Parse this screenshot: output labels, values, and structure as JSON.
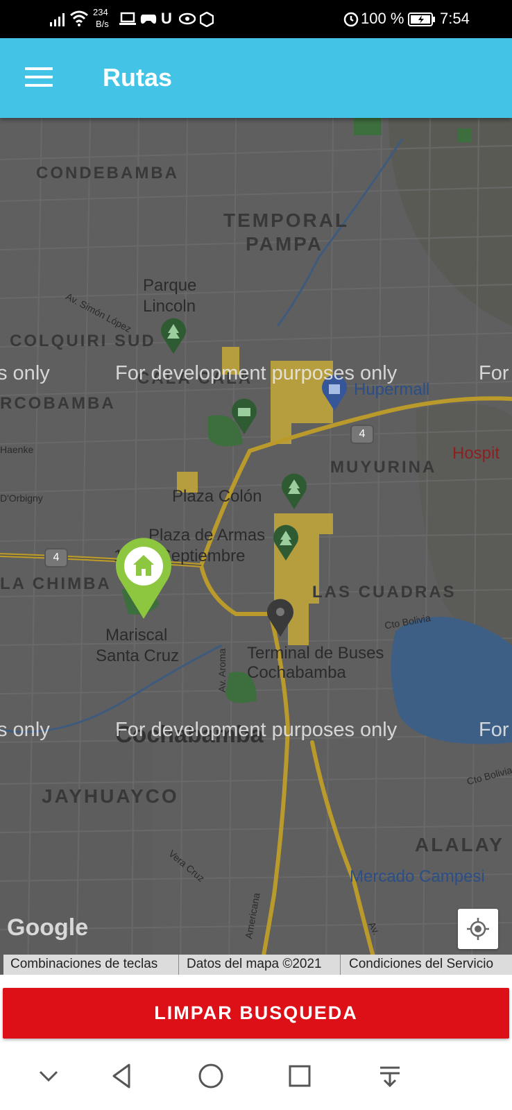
{
  "status_bar": {
    "net_speed_value": "234",
    "net_speed_unit": "B/s",
    "battery_percent": "100 %",
    "time": "7:54",
    "icons": [
      "signal-icon",
      "wifi-icon",
      "laptop-icon",
      "controller-icon",
      "u-icon",
      "eye-icon",
      "hex-icon",
      "alarm-icon",
      "battery-icon"
    ]
  },
  "app_bar": {
    "title": "Rutas",
    "menu_icon": "hamburger-menu-icon"
  },
  "map": {
    "neighborhoods": [
      "CONDEBAMBA",
      "TEMPORAL",
      "PAMPA",
      "COLQUIRI SUD",
      "RCOBAMBA",
      "MUYURINA",
      "LA CHIMBA",
      "LAS CUADRAS",
      "JAYHUAYCO",
      "ALALAY"
    ],
    "places": {
      "parque_lincoln_1": "Parque",
      "parque_lincoln_2": "Lincoln",
      "hupermall": "Hupermall",
      "hospit": "Hospit",
      "plaza_colon": "Plaza Colón",
      "plaza_armas_1": "Plaza de Armas",
      "plaza_armas_2": "14 de Septiembre",
      "mariscal_1": "Mariscal",
      "mariscal_2": "Santa Cruz",
      "terminal_1": "Terminal de Buses",
      "terminal_2": "Cochabamba",
      "city": "Cochabamba",
      "mercado": "Mercado Campesi",
      "cala_cala": "CALA CALA"
    },
    "streets": {
      "simon_lopez": "Av. Simón López",
      "haenke": "Haenke",
      "dorbigny": "D'Orbigny",
      "aroma": "Av. Aroma",
      "cto_bolivia_1": "Cto Bolivia",
      "cto_bolivia_2": "Cto Bolivia",
      "vera_cruz": "Vera Cruz",
      "americana": "Americana",
      "av": "Av."
    },
    "route_shields": [
      "4",
      "4"
    ],
    "watermark": "For development purposes only",
    "watermark_left": "s only",
    "watermark_right": "For",
    "home_marker": "home-marker-icon",
    "google_logo": "Google",
    "locate_icon": "my-location-icon",
    "attribution": {
      "shortcuts": "Combinaciones de teclas",
      "map_data": "Datos del mapa ©2021",
      "terms": "Condiciones del Servicio"
    }
  },
  "clear_button": {
    "label": "LIMPAR BUSQUEDA"
  },
  "nav_bar": {
    "icons": [
      "chevron-down-icon",
      "back-icon",
      "home-icon",
      "recents-icon",
      "notification-pull-icon"
    ]
  },
  "colors": {
    "app_bar": "#43c4e6",
    "clear_button": "#dd1018",
    "marker": "#8dc63f",
    "map_bg": "#5f5f5f"
  }
}
